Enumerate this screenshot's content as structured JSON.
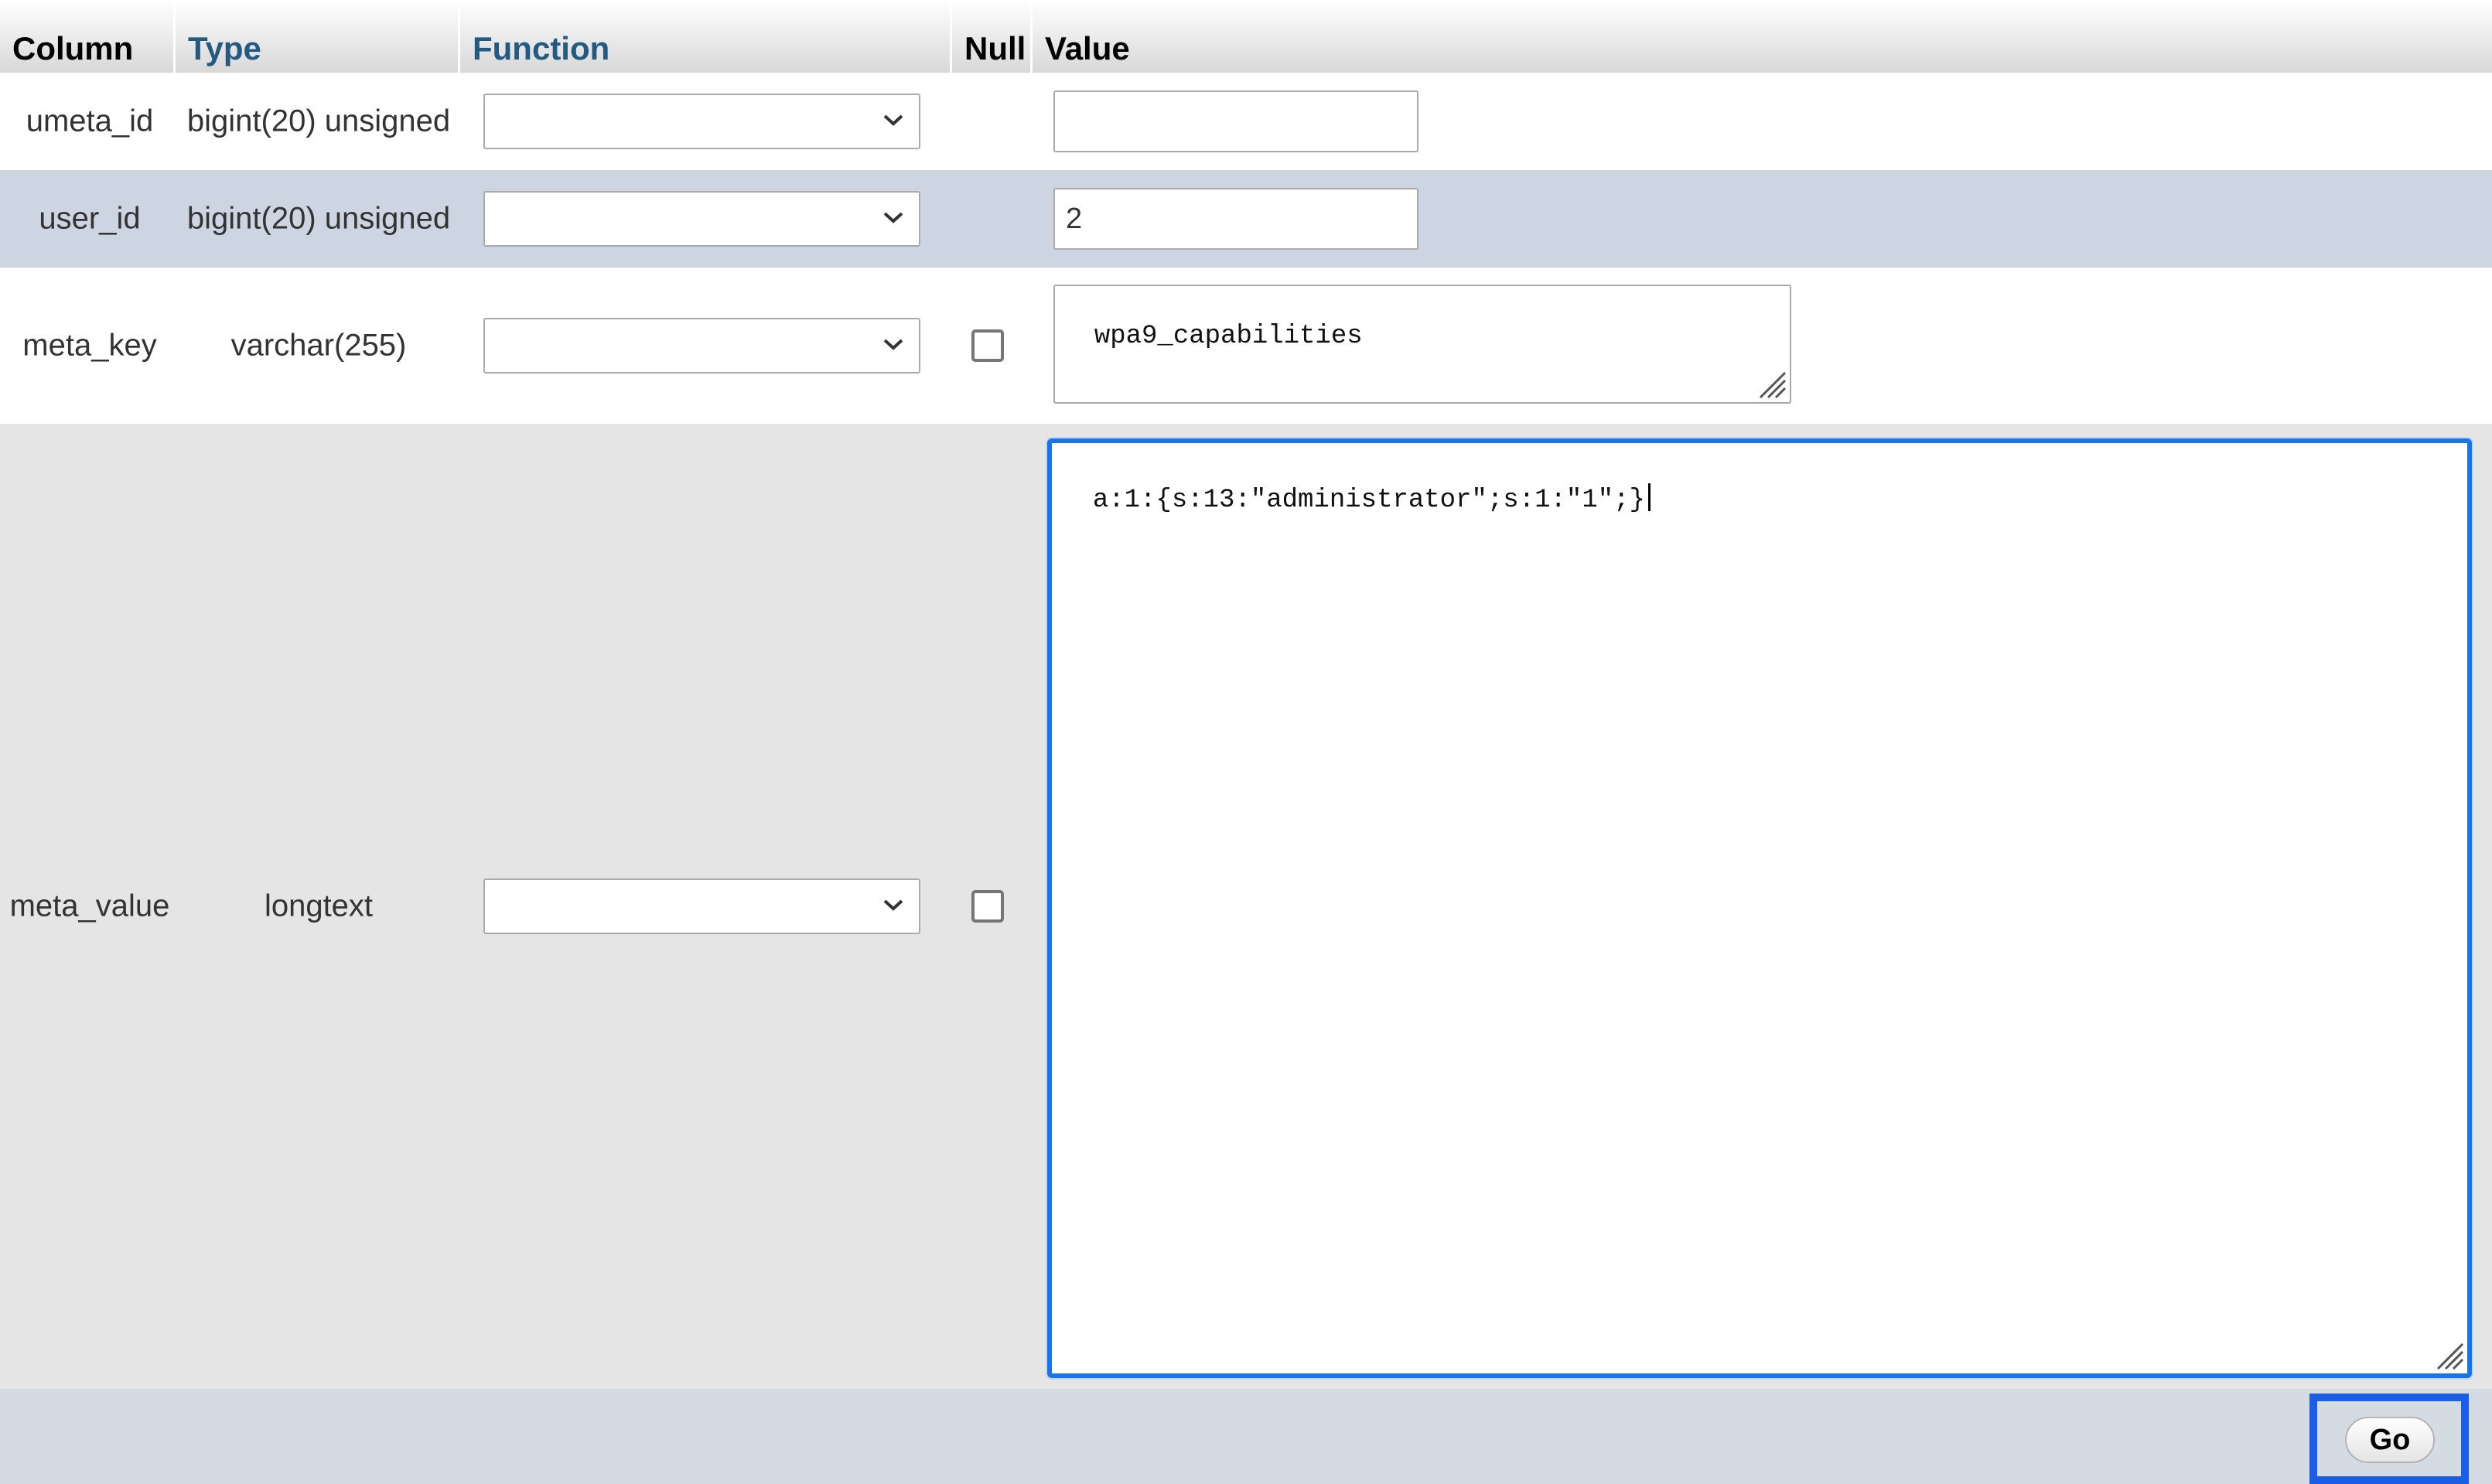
{
  "header": {
    "column": "Column",
    "type": "Type",
    "function": "Function",
    "null": "Null",
    "value": "Value"
  },
  "rows": [
    {
      "column": "umeta_id",
      "type": "bigint(20) unsigned",
      "function": "",
      "has_null_checkbox": false,
      "value": ""
    },
    {
      "column": "user_id",
      "type": "bigint(20) unsigned",
      "function": "",
      "has_null_checkbox": false,
      "value": "2"
    },
    {
      "column": "meta_key",
      "type": "varchar(255)",
      "function": "",
      "has_null_checkbox": true,
      "null_checked": false,
      "value": "wpa9_capabilities"
    },
    {
      "column": "meta_value",
      "type": "longtext",
      "function": "",
      "has_null_checkbox": true,
      "null_checked": false,
      "value": "a:1:{s:13:\"administrator\";s:1:\"1\";}"
    }
  ],
  "footer": {
    "go_label": "Go"
  },
  "colors": {
    "header_link": "#235a81",
    "row_highlight": "#ccd5e1",
    "row_alt": "#e5e5e5",
    "focus_border": "#1a73e8",
    "go_highlight": "#1a5ee6"
  }
}
